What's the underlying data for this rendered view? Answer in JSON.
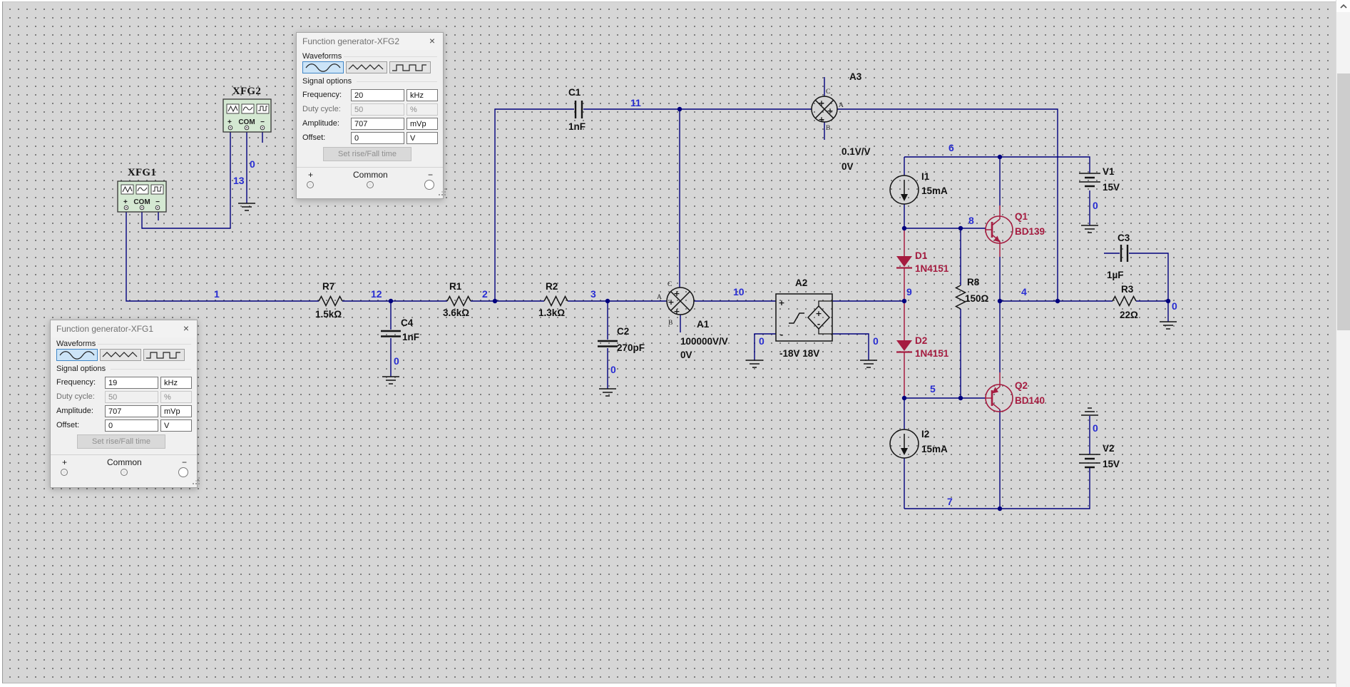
{
  "fg_dialog_labels": {
    "waveforms": "Waveforms",
    "signal_options": "Signal options",
    "frequency": "Frequency:",
    "duty_cycle": "Duty cycle:",
    "amplitude": "Amplitude:",
    "offset": "Offset:",
    "set_rise_fall": "Set rise/Fall time",
    "plus": "+",
    "common": "Common",
    "minus": "−",
    "close": "×"
  },
  "xfg2_dialog": {
    "title": "Function generator-XFG2",
    "frequency": "20",
    "frequency_unit": "kHz",
    "duty_cycle": "50",
    "duty_unit": "%",
    "amplitude": "707",
    "amplitude_unit": "mVp",
    "offset": "0",
    "offset_unit": "V"
  },
  "xfg1_dialog": {
    "title": "Function generator-XFG1",
    "frequency": "19",
    "frequency_unit": "kHz",
    "duty_cycle": "50",
    "duty_unit": "%",
    "amplitude": "707",
    "amplitude_unit": "mVp",
    "offset": "0",
    "offset_unit": "V"
  },
  "schematic": {
    "instruments": {
      "xfg1": "XFG1",
      "xfg2": "XFG2",
      "plus": "+",
      "com": "COM",
      "minus": "−"
    },
    "components": {
      "c1": {
        "ref": "C1",
        "value": "1nF"
      },
      "c2": {
        "ref": "C2",
        "value": "270pF"
      },
      "c3": {
        "ref": "C3",
        "value": "1µF"
      },
      "c4": {
        "ref": "C4",
        "value": "1nF"
      },
      "r1": {
        "ref": "R1",
        "value": "3.6kΩ"
      },
      "r2": {
        "ref": "R2",
        "value": "1.3kΩ"
      },
      "r3": {
        "ref": "R3",
        "value": "22Ω"
      },
      "r7": {
        "ref": "R7",
        "value": "1.5kΩ"
      },
      "r8": {
        "ref": "R8",
        "value": "150Ω"
      },
      "a1": {
        "ref": "A1",
        "value": "100000V/V",
        "value2": "0V"
      },
      "a2": {
        "ref": "A2",
        "value": "-18V 18V"
      },
      "a3": {
        "ref": "A3",
        "value": "0.1V/V",
        "value2": "0V"
      },
      "i1": {
        "ref": "I1",
        "value": "15mA"
      },
      "i2": {
        "ref": "I2",
        "value": "15mA"
      },
      "v1": {
        "ref": "V1",
        "value": "15V"
      },
      "v2": {
        "ref": "V2",
        "value": "15V"
      },
      "d1": {
        "ref": "D1",
        "value": "1N4151"
      },
      "d2": {
        "ref": "D2",
        "value": "1N4151"
      },
      "q1": {
        "ref": "Q1",
        "value": "BD139"
      },
      "q2": {
        "ref": "Q2",
        "value": "BD140"
      }
    },
    "nets": {
      "n0": "0",
      "n1": "1",
      "n2": "2",
      "n3": "3",
      "n4": "4",
      "n5": "5",
      "n6": "6",
      "n7": "7",
      "n8": "8",
      "n9": "9",
      "n10": "10",
      "n11": "11",
      "n12": "12",
      "n13": "13"
    },
    "terminals": {
      "a": "A",
      "b": "B",
      "c": "C",
      "plus": "+",
      "minus": "-"
    },
    "colors": {
      "wire": "#00007d",
      "net_label": "#282dd2",
      "semiconductor": "#a51c40",
      "canvas": "#d6d6d6"
    }
  }
}
